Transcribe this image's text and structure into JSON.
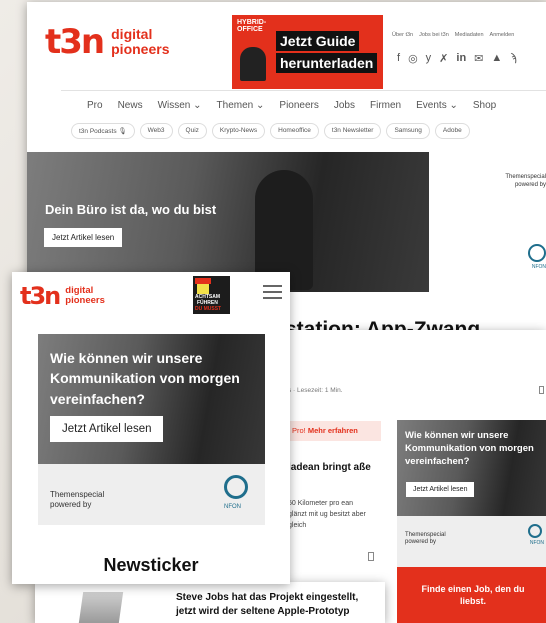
{
  "desktop": {
    "logo": {
      "mark": "t3n",
      "line1": "digital",
      "line2": "pioneers"
    },
    "banner": {
      "tag1": "HYBRID-",
      "tag2": "OFFICE",
      "line1": "Jetzt Guide",
      "line2": "herunterladen"
    },
    "top_links": [
      "Über t3n",
      "Jobs bei t3n",
      "Mediadaten",
      "Anmelden"
    ],
    "social_icons": [
      "facebook-icon",
      "instagram-icon",
      "twitter-icon",
      "xing-icon",
      "linkedin-icon",
      "mail-icon",
      "bell-icon",
      "rss-icon"
    ],
    "nav": [
      "Pro",
      "News",
      "Wissen",
      "Themen",
      "Pioneers",
      "Jobs",
      "Firmen",
      "Events",
      "Shop"
    ],
    "nav_dropdown": [
      "Wissen",
      "Themen",
      "Events"
    ],
    "tags": [
      "t3n Podcasts",
      "Web3",
      "Quiz",
      "Krypto-News",
      "Homeoffice",
      "t3n Newsletter",
      "Samsung",
      "Adobe"
    ],
    "hero": {
      "title": "Dein Büro ist da, wo du bist",
      "button": "Jetzt Artikel lesen",
      "sponsor1": "Themenspecial",
      "sponsor2": "powered by",
      "sponsor_logo": "NFON"
    },
    "headline_partial": "station: App-Zwang"
  },
  "article": {
    "meta": "s · Lesezeit: 1 Min.",
    "pro_banner": "Pro!",
    "pro_link": "Mehr erfahren",
    "story1_title": "ladean bringt aße",
    "story1_text": "50 Kilometer pro ean glänzt mit ug besitzt aber gleich",
    "story2_title": "Steve Jobs hat das Projekt eingestellt, jetzt wird der seltene Apple-Prototyp",
    "side_ad": {
      "title": "Wie können wir unsere Kommunikation von morgen vereinfachen?",
      "button": "Jetzt Artikel lesen",
      "sponsor1": "Themenspecial",
      "sponsor2": "powered by",
      "logo": "NFON"
    },
    "job_box": "Finde einen Job, den du liebst."
  },
  "mobile": {
    "logo": {
      "mark": "t3n",
      "line1": "digital",
      "line2": "pioneers"
    },
    "mag_line1": "ACHTSAM",
    "mag_line2": "FÜHREN",
    "mag_line3": "DU MUSST",
    "ad": {
      "title": "Wie können wir unsere Kommunikation von morgen vereinfachen?",
      "button": "Jetzt Artikel lesen",
      "sponsor1": "Themenspecial",
      "sponsor2": "powered by",
      "logo": "NFON"
    },
    "section": "Newsticker"
  }
}
